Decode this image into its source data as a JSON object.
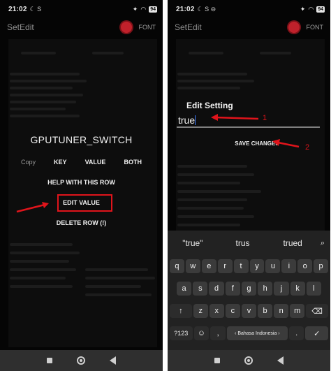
{
  "left": {
    "status": {
      "time": "21:02",
      "icons_left": "☾ S",
      "battery": "94"
    },
    "app_title": "SetEdit",
    "font_label": "FONT",
    "dialog": {
      "title": "GPUTUNER_SWITCH",
      "options": [
        "Copy",
        "KEY",
        "VALUE",
        "BOTH"
      ],
      "help": "HELP WITH THIS ROW",
      "edit": "EDIT VALUE",
      "delete": "DELETE ROW (!)"
    }
  },
  "right": {
    "status": {
      "time": "21:02",
      "icons_left": "☾ S ⊖",
      "battery": "94"
    },
    "app_title": "SetEdit",
    "font_label": "FONT",
    "dialog": {
      "title": "Edit Setting",
      "value": "true",
      "save": "SAVE CHANGES"
    },
    "annotations": {
      "one": "1",
      "two": "2"
    },
    "keyboard": {
      "suggestions": [
        "\"true\"",
        "trus",
        "trued"
      ],
      "row1": [
        "q",
        "w",
        "e",
        "r",
        "t",
        "y",
        "u",
        "i",
        "o",
        "p"
      ],
      "row2": [
        "a",
        "s",
        "d",
        "f",
        "g",
        "h",
        "j",
        "k",
        "l"
      ],
      "row3": [
        "↑",
        "z",
        "x",
        "c",
        "v",
        "b",
        "n",
        "m",
        "⌫"
      ],
      "row4": {
        "num": "?123",
        "emoji": "☺",
        "comma": ",",
        "space": "‹  Bahasa Indonesia  ›",
        "period": ".",
        "enter": "✓"
      }
    }
  },
  "colors": {
    "annotation": "#e0141b",
    "gear": "#c0212b",
    "background": "#050505"
  }
}
